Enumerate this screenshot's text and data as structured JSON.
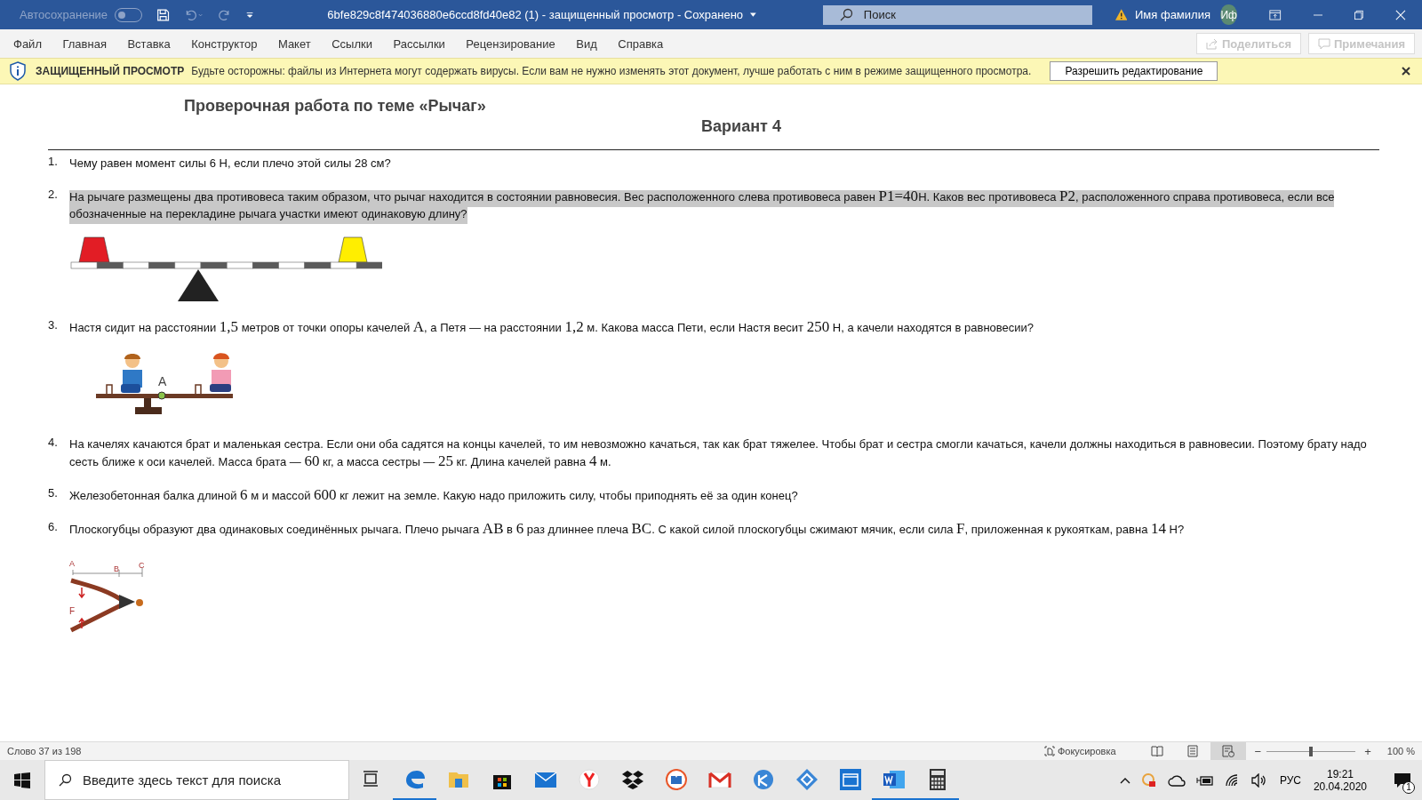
{
  "window": {
    "title": "6bfe829c8f474036880e6ccd8fd40e82 (1)  -  защищенный просмотр  -  Сохранено",
    "autosave_label": "Автосохранение",
    "autosave_on": false,
    "search_placeholder": "Поиск",
    "user_name": "Имя фамилия",
    "user_initials": "Иф"
  },
  "ribbon_tabs": [
    {
      "label": "Файл",
      "selected": false
    },
    {
      "label": "Главная",
      "selected": false
    },
    {
      "label": "Вставка",
      "selected": false
    },
    {
      "label": "Конструктор",
      "selected": false
    },
    {
      "label": "Макет",
      "selected": false
    },
    {
      "label": "Ссылки",
      "selected": false
    },
    {
      "label": "Рассылки",
      "selected": false
    },
    {
      "label": "Рецензирование",
      "selected": false
    },
    {
      "label": "Вид",
      "selected": false
    },
    {
      "label": "Справка",
      "selected": false
    }
  ],
  "ribbon_buttons": [
    {
      "label": "Поделиться",
      "kind": "share",
      "disabled": true
    },
    {
      "label": "Примечания",
      "kind": "comments",
      "disabled": true
    }
  ],
  "protected_bar": {
    "title": "ЗАЩИЩЕННЫЙ ПРОСМОТР",
    "message": "Будьте осторожны: файлы из Интернета могут содержать вирусы. Если вам не нужно изменять этот документ, лучше работать с ним в режиме защищенного просмотра.",
    "button": "Разрешить редактирование"
  },
  "document": {
    "title": "Проверочная работа по теме «Рычаг»",
    "subtitle": "Вариант 4",
    "questions": [
      {
        "number": "1.",
        "highlighted": false,
        "parts": [
          {
            "kind": "text",
            "text": "Чему равен момент силы 6 Н, если плечо этой силы 28 см?"
          }
        ]
      },
      {
        "number": "2.",
        "highlighted": true,
        "figure": {
          "kind": "lever"
        },
        "parts": [
          {
            "kind": "text",
            "text": " На рычаге размещены два противовеса таким образом, что рычаг находится в состоянии равновесия. Вес расположенного слева противовеса равен "
          },
          {
            "kind": "math",
            "text": "P1=40"
          },
          {
            "kind": "text",
            "text": "Н.  Каков вес противовеса "
          },
          {
            "kind": "math",
            "text": "P2"
          },
          {
            "kind": "text",
            "text": ", расположенного справа противовеса, если все обозначенные на перекладине рычага участки имеют одинаковую длину?"
          }
        ]
      },
      {
        "number": "3.",
        "highlighted": false,
        "figure": {
          "kind": "seesaw",
          "labels": [
            "A"
          ]
        },
        "parts": [
          {
            "kind": "text",
            "text": "Настя сидит на расстоянии "
          },
          {
            "kind": "math",
            "text": "1,5"
          },
          {
            "kind": "text",
            "text": " метров от точки опоры качелей "
          },
          {
            "kind": "math",
            "text": "A"
          },
          {
            "kind": "text",
            "text": ", а Петя — на расстоянии "
          },
          {
            "kind": "math",
            "text": "1,2"
          },
          {
            "kind": "text",
            "text": " м. Какова масса Пети, если Настя весит "
          },
          {
            "kind": "math",
            "text": "250"
          },
          {
            "kind": "text",
            "text": " Н, а качели находятся в равновесии?"
          }
        ]
      },
      {
        "number": "4.",
        "highlighted": false,
        "parts": [
          {
            "kind": "text",
            "text": "На качелях качаются брат и маленькая сестра. Если они оба садятся на концы качелей, то им невозможно качаться, так как брат тяжелее. Чтобы брат и сестра смогли качаться, качели должны находиться в равновесии. Поэтому брату надо сесть ближе к оси качелей. Масса брата — "
          },
          {
            "kind": "math",
            "text": "60"
          },
          {
            "kind": "text",
            "text": " кг, а масса сестры — "
          },
          {
            "kind": "math",
            "text": "25"
          },
          {
            "kind": "text",
            "text": " кг. Длина качелей равна "
          },
          {
            "kind": "math",
            "text": "4"
          },
          {
            "kind": "text",
            "text": " м."
          }
        ]
      },
      {
        "number": "5.",
        "highlighted": false,
        "parts": [
          {
            "kind": "text",
            "text": "Железобетонная балка длиной "
          },
          {
            "kind": "math",
            "text": "6"
          },
          {
            "kind": "text",
            "text": " м и массой "
          },
          {
            "kind": "math",
            "text": "600"
          },
          {
            "kind": "text",
            "text": " кг лежит на земле. Какую надо приложить силу, чтобы приподнять её за один конец?"
          }
        ]
      },
      {
        "number": "6.",
        "highlighted": false,
        "figure": {
          "kind": "pliers",
          "labels": [
            "A",
            "B",
            "C",
            "F"
          ]
        },
        "parts": [
          {
            "kind": "text",
            "text": "Плоскогубцы образуют два одинаковых соединённых рычага. Плечо рычага "
          },
          {
            "kind": "math",
            "text": "AB"
          },
          {
            "kind": "text",
            "text": " в "
          },
          {
            "kind": "math",
            "text": "6"
          },
          {
            "kind": "text",
            "text": " раз длиннее плеча "
          },
          {
            "kind": "math",
            "text": "BC"
          },
          {
            "kind": "text",
            "text": ". С какой силой плоскогубцы сжимают мячик, если сила "
          },
          {
            "kind": "math",
            "text": "F"
          },
          {
            "kind": "text",
            "text": ", приложенная к рукояткам, равна "
          },
          {
            "kind": "math",
            "text": "14"
          },
          {
            "kind": "text",
            "text": " Н?"
          }
        ]
      }
    ]
  },
  "status_bar": {
    "word_count": "Слово 37 из 198",
    "focus": "Фокусировка",
    "views": [
      {
        "kind": "read",
        "selected": false
      },
      {
        "kind": "print",
        "selected": false
      },
      {
        "kind": "web",
        "selected": true
      }
    ],
    "zoom_out": "−",
    "zoom_slider": {
      "level": 0.5
    },
    "zoom_in": "+",
    "zoom": "100 %"
  },
  "taskbar": {
    "search_placeholder": "Введите здесь текст для поиска",
    "apps": [
      {
        "kind": "taskview",
        "running": false
      },
      {
        "kind": "edge",
        "running": true
      },
      {
        "kind": "folder",
        "running": false
      },
      {
        "kind": "store",
        "running": false
      },
      {
        "kind": "mail",
        "running": false
      },
      {
        "kind": "yandex",
        "running": false
      },
      {
        "kind": "dropbox",
        "running": false
      },
      {
        "kind": "book",
        "running": false
      },
      {
        "kind": "gmail",
        "running": false
      },
      {
        "kind": "circle",
        "running": false
      },
      {
        "kind": "diamond",
        "running": false
      },
      {
        "kind": "window",
        "running": false
      },
      {
        "kind": "word",
        "running": true
      },
      {
        "kind": "calculator",
        "running": true
      }
    ],
    "language": "РУС",
    "time": "19:21",
    "date": "20.04.2020",
    "notifications": "1"
  }
}
